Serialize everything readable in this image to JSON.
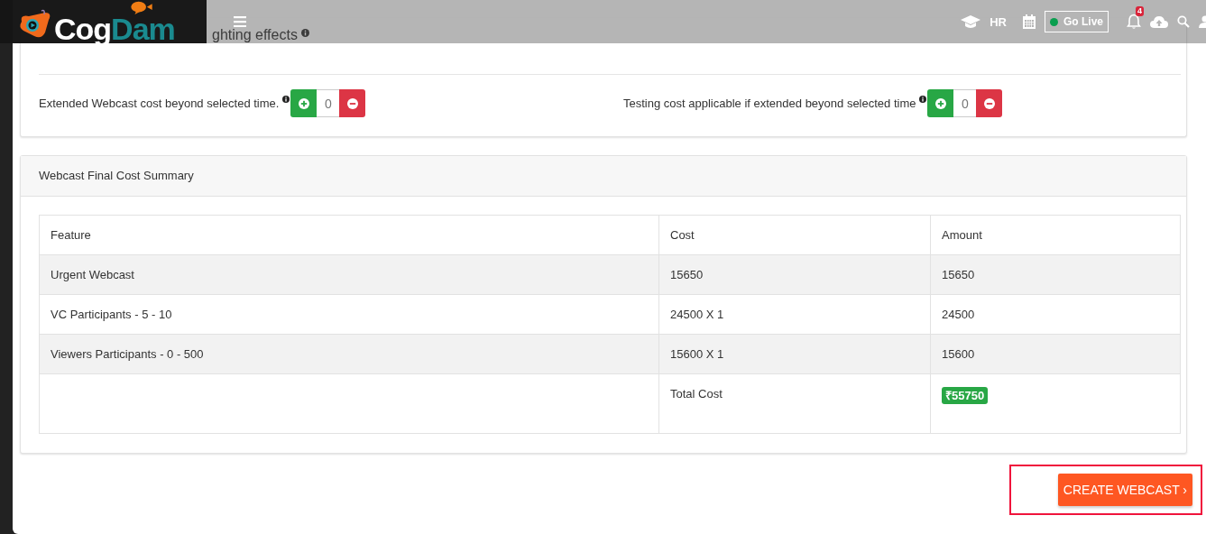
{
  "header": {
    "logo": {
      "first": "Cog",
      "second": "Dam"
    },
    "user_label": "HR",
    "go_live": {
      "label": "Go Live",
      "online": true
    },
    "notifications": "4"
  },
  "options_card": {
    "partial_option": "ghting effects",
    "extensions": [
      {
        "label": "Extended Webcast cost beyond selected time.",
        "value": "0"
      },
      {
        "label": "Testing cost applicable if extended beyond selected time",
        "value": "0"
      }
    ]
  },
  "summary": {
    "title": "Webcast Final Cost Summary",
    "columns": [
      "Feature",
      "Cost",
      "Amount"
    ],
    "rows": [
      [
        "Urgent Webcast",
        "15650",
        "15650"
      ],
      [
        "VC Participants - 5 - 10",
        "24500 X 1",
        "24500"
      ],
      [
        "Viewers Participants - 0 - 500",
        "15600 X 1",
        "15600"
      ]
    ],
    "total": {
      "label": "Total Cost",
      "amount": "₹55750"
    }
  },
  "create_button": "CREATE WEBCAST ›"
}
